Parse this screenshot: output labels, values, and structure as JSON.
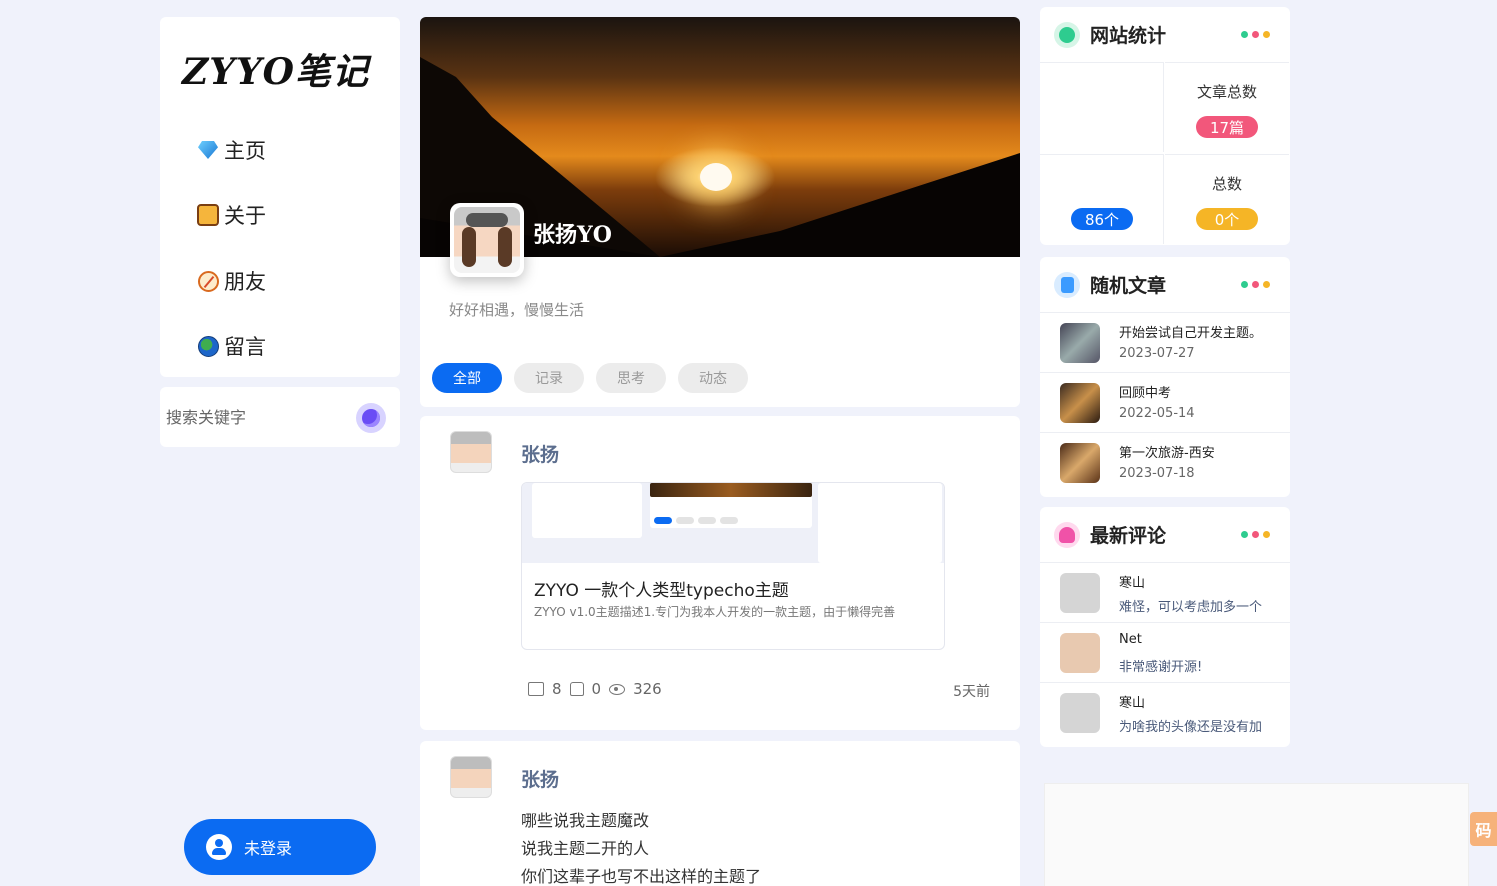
{
  "site": {
    "logo": "ZYYO笔记"
  },
  "nav": {
    "items": [
      {
        "label": "主页",
        "icon": "diamond-icon"
      },
      {
        "label": "关于",
        "icon": "hands-icon"
      },
      {
        "label": "朋友",
        "icon": "compass-icon"
      },
      {
        "label": "留言",
        "icon": "globe-icon"
      }
    ]
  },
  "search": {
    "placeholder": "搜索关键字"
  },
  "login": {
    "label": "未登录"
  },
  "profile": {
    "name": "张扬YO",
    "bio": "好好相遇，慢慢生活",
    "tabs": [
      "全部",
      "记录",
      "思考",
      "动态"
    ]
  },
  "posts": [
    {
      "author": "张扬",
      "link_title": "ZYYO 一款个人类型typecho主题",
      "link_desc": "ZYYO v1.0主题描述1.专门为我本人开发的一款主题，由于懒得完善",
      "comments": "8",
      "likes": "0",
      "views": "326",
      "time": "5天前"
    },
    {
      "author": "张扬",
      "lines": [
        "哪些说我主题魔改",
        "说我主题二开的人",
        "你们这辈子也写不出这样的主题了"
      ]
    }
  ],
  "stats": {
    "title": "网站统计",
    "cells": [
      {
        "label": "",
        "value": ""
      },
      {
        "label": "文章总数",
        "value": "17篇"
      },
      {
        "label": "",
        "value": "86个"
      },
      {
        "label": "总数",
        "value": "0个"
      }
    ]
  },
  "random": {
    "title": "随机文章",
    "items": [
      {
        "title": "开始尝试自己开发主题。",
        "date": "2023-07-27"
      },
      {
        "title": "回顾中考",
        "date": "2022-05-14"
      },
      {
        "title": "第一次旅游-西安",
        "date": "2023-07-18"
      }
    ]
  },
  "comments": {
    "title": "最新评论",
    "items": [
      {
        "name": "寒山",
        "text": "难怪，可以考虑加多一个"
      },
      {
        "name": "Net",
        "text": "非常感谢开源!"
      },
      {
        "name": "寒山",
        "text": "为啥我的头像还是没有加"
      }
    ]
  },
  "corner": {
    "label": "码"
  },
  "colors": {
    "accent": "#0b6bf2",
    "dot_green": "#2ecc8f",
    "dot_red": "#f2577b",
    "dot_yellow": "#f5b526"
  }
}
